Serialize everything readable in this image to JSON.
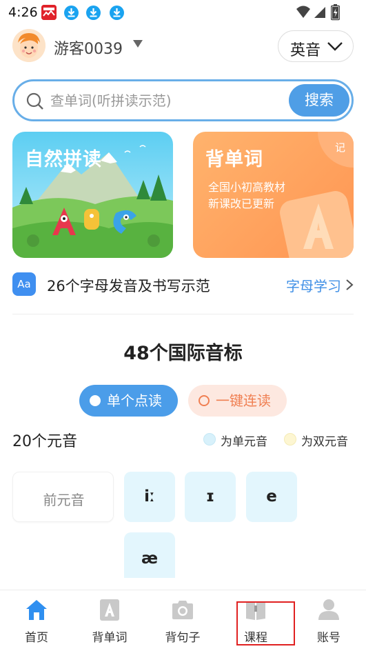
{
  "status_bar": {
    "time": "4:26",
    "app_icons": [
      "news-app-icon",
      "download-icon",
      "download-icon",
      "download-icon"
    ],
    "right_icons": [
      "wifi-icon",
      "signal-icon",
      "battery-icon"
    ]
  },
  "header": {
    "username": "游客0039",
    "language": "英音"
  },
  "search": {
    "placeholder": "查单词(听拼读示范)",
    "button": "搜索"
  },
  "cards": {
    "phonics": {
      "title": "自然拼读"
    },
    "words": {
      "title": "背单词",
      "subtitle_line1": "全国小初高教材",
      "subtitle_line2": "新课改已更新",
      "badge": "记"
    }
  },
  "alphabet": {
    "icon_text": "Aa",
    "text": "26个字母发音及书写示范",
    "link": "字母学习"
  },
  "section": {
    "title": "48个国际音标"
  },
  "modes": {
    "single": "单个点读",
    "continuous": "一键连读"
  },
  "vowels": {
    "count_label": "20个元音",
    "legend_single": "为单元音",
    "legend_double": "为双元音",
    "category": "前元音",
    "phonemes": [
      "iː",
      "ɪ",
      "e",
      "æ"
    ]
  },
  "nav": {
    "items": [
      {
        "label": "首页",
        "icon": "home-icon"
      },
      {
        "label": "背单词",
        "icon": "word-card-icon"
      },
      {
        "label": "背句子",
        "icon": "camera-icon"
      },
      {
        "label": "课程",
        "icon": "book-icon"
      },
      {
        "label": "账号",
        "icon": "person-icon"
      }
    ]
  },
  "colors": {
    "accent_blue": "#4b9de9",
    "orange": "#ff9552",
    "phoneme_bg": "#e3f6fd",
    "legend_single": "#d8f1fb",
    "legend_double": "#fdf6d2",
    "highlight": "#e02020"
  }
}
